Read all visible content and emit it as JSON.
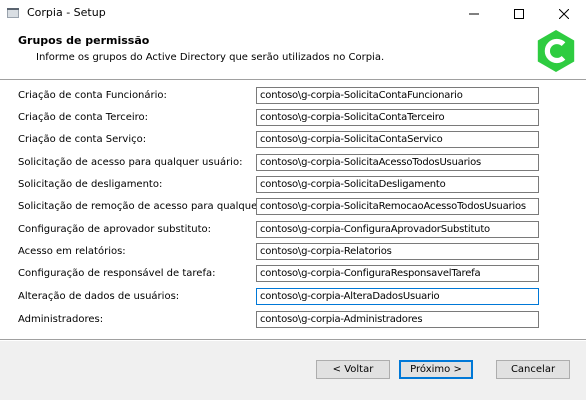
{
  "window": {
    "title": "Corpia - Setup"
  },
  "header": {
    "title": "Grupos de permissão",
    "subtitle": "Informe os grupos do Active Directory que serão utilizados no Corpia.",
    "logo_icon": "corpia-logo",
    "logo_letter": "C",
    "logo_color": "#2ecc40"
  },
  "fields": [
    {
      "label": "Criação de conta Funcionário:",
      "value": "contoso\\g-corpia-SolicitaContaFuncionario"
    },
    {
      "label": "Criação de conta Terceiro:",
      "value": "contoso\\g-corpia-SolicitaContaTerceiro"
    },
    {
      "label": "Criação de conta Serviço:",
      "value": "contoso\\g-corpia-SolicitaContaServico"
    },
    {
      "label": "Solicitação de acesso para qualquer usuário:",
      "value": "contoso\\g-corpia-SolicitaAcessoTodosUsuarios"
    },
    {
      "label": "Solicitação de desligamento:",
      "value": "contoso\\g-corpia-SolicitaDesligamento"
    },
    {
      "label": "Solicitação de remoção de acesso para qualquer usuário:",
      "value": "contoso\\g-corpia-SolicitaRemocaoAcessoTodosUsuarios"
    },
    {
      "label": "Configuração de aprovador substituto:",
      "value": "contoso\\g-corpia-ConfiguraAprovadorSubstituto"
    },
    {
      "label": "Acesso em relatórios:",
      "value": "contoso\\g-corpia-Relatorios"
    },
    {
      "label": "Configuração de responsável de tarefa:",
      "value": "contoso\\g-corpia-ConfiguraResponsavelTarefa"
    },
    {
      "label": "Alteração de dados de usuários:",
      "value": "contoso\\g-corpia-AlteraDadosUsuario",
      "focused": true
    },
    {
      "label": "Administradores:",
      "value": "contoso\\g-corpia-Administradores"
    }
  ],
  "buttons": {
    "back": "< Voltar",
    "next": "Próximo >",
    "cancel": "Cancelar"
  },
  "colors": {
    "accent": "#0078d7",
    "footer_bg": "#f0f0f0"
  }
}
